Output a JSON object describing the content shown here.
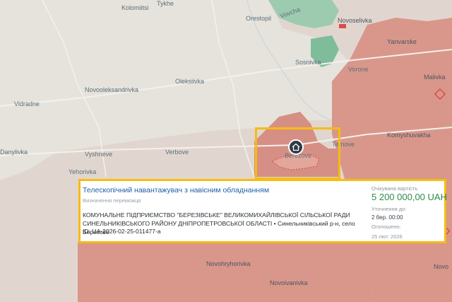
{
  "map": {
    "places": [
      {
        "id": "kolomiitsi",
        "label": "Kolomiitsi"
      },
      {
        "id": "tykhe",
        "label": "Tykhe"
      },
      {
        "id": "vovcha",
        "label": "Vovcha"
      },
      {
        "id": "novoselivka",
        "label": "Novoselivka"
      },
      {
        "id": "orestopil",
        "label": "Orestopil"
      },
      {
        "id": "yanvarske",
        "label": "Yanvarske"
      },
      {
        "id": "sosnivka",
        "label": "Sosnivka"
      },
      {
        "id": "vorone",
        "label": "Vorone"
      },
      {
        "id": "malivka",
        "label": "Malivka"
      },
      {
        "id": "novooleksandrivka",
        "label": "Novooleksandrivka"
      },
      {
        "id": "oleksiivka",
        "label": "Oleksiivka"
      },
      {
        "id": "vidradne",
        "label": "Vidradne"
      },
      {
        "id": "komyshuvakha",
        "label": "Komyshuvakha"
      },
      {
        "id": "danylivka",
        "label": "Danylivka"
      },
      {
        "id": "vyshneve",
        "label": "Vyshneve"
      },
      {
        "id": "verbove",
        "label": "Verbove"
      },
      {
        "id": "ternove",
        "label": "Ternove"
      },
      {
        "id": "berezove",
        "label": "Berezove"
      },
      {
        "id": "yehorivka",
        "label": "Yehorivka"
      },
      {
        "id": "novohryhorivka",
        "label": "Novohryhorivka"
      },
      {
        "id": "novoivanivka",
        "label": "Novoivanivka"
      },
      {
        "id": "novoe",
        "label": "Novo"
      }
    ],
    "colors": {
      "base": "#e6e3dc",
      "occupied": "#d9978b",
      "contested": "#e2cbc4",
      "forest": "#7fbd9a",
      "road": "#f3f1ec",
      "highlight": "#f4bd12",
      "marker": "#d94d48"
    }
  },
  "card": {
    "title": "Телескопічний навантажувач з навісним обладнанням",
    "subtitle": "Визначення переможця",
    "org": "КОМУНАЛЬНЕ ПІДПРИЄМСТВО \"БЕРЕЗІВСЬКЕ\" ВЕЛИКОМИХАЙЛІВСЬКОЇ СІЛЬСЬКОЇ РАДИ СИНЕЛЬНИКІВСЬКОГО РАЙОНУ ДНІПРОПЕТРОВСЬКОЇ ОБЛАСТІ • Синельниківський р-н, село Березове",
    "id": "ID: UA-2026-02-25-011477-a",
    "price_label": "Очікувана вартість",
    "price": "5 200 000,00 UAH",
    "deadline_label": "Уточнення до:",
    "deadline": "2 бер. 00:00",
    "published_label": "Оголошено:",
    "published": "25 лют. 2026"
  }
}
